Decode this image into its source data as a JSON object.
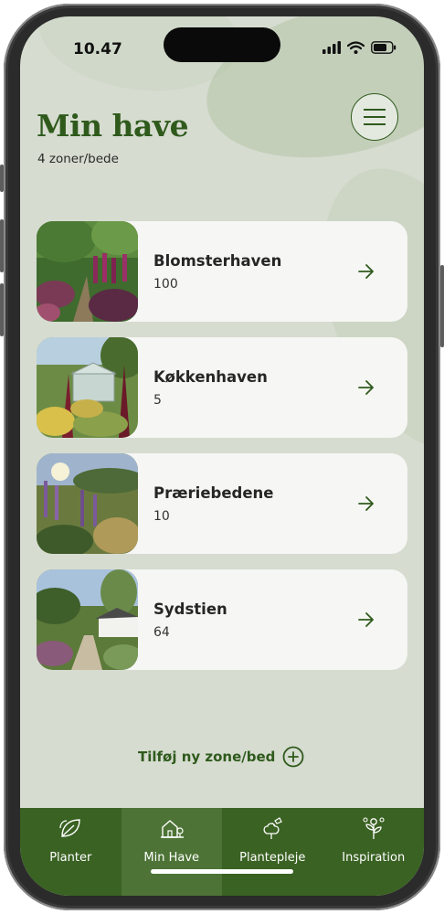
{
  "status_bar": {
    "time": "10.47"
  },
  "header": {
    "title": "Min have",
    "subtitle": "4 zoner/bede"
  },
  "menu_icon": "hamburger-menu-icon",
  "zones": [
    {
      "name": "Blomsterhaven",
      "count": "100"
    },
    {
      "name": "Køkkenhaven",
      "count": "5"
    },
    {
      "name": "Præriebedene",
      "count": "10"
    },
    {
      "name": "Sydstien",
      "count": "64"
    }
  ],
  "add_zone": {
    "label": "Tilføj ny zone/bed"
  },
  "nav": [
    {
      "label": "Planter",
      "icon": "leaf-icon"
    },
    {
      "label": "Min Have",
      "icon": "house-garden-icon"
    },
    {
      "label": "Plantepleje",
      "icon": "watering-can-icon"
    },
    {
      "label": "Inspiration",
      "icon": "flower-sprig-icon"
    }
  ],
  "active_tab": "Min Have",
  "colors": {
    "primary_green": "#2f5a1c",
    "nav_bg": "#3a6223",
    "nav_active": "#4d7436",
    "screen_bg": "#d6dcd0",
    "card_bg": "#f6f6f4"
  }
}
